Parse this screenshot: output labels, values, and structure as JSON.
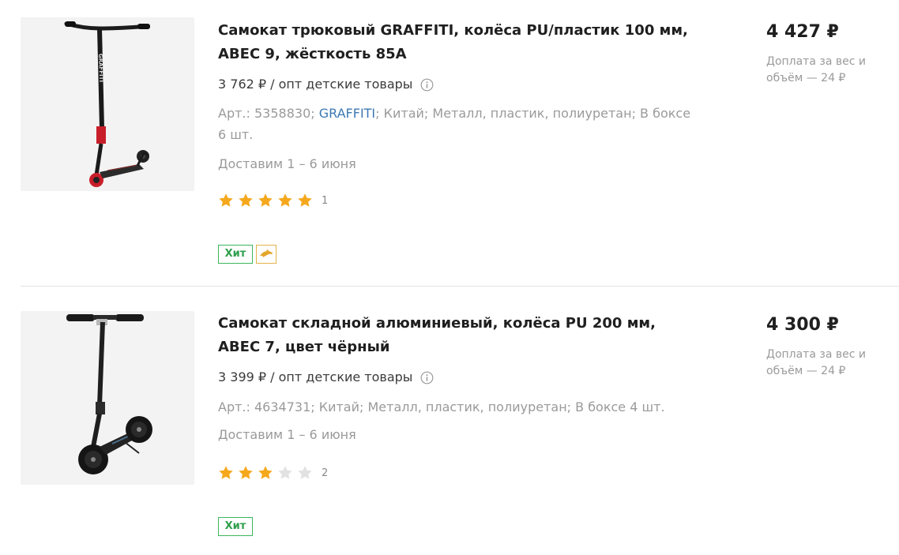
{
  "products": [
    {
      "title": "Самокат трюковый GRAFFITI, колёса PU/пластик 100 мм, ABEC 9, жёсткость 85A",
      "wholesale_price": "3 762 ₽ / опт детские товары",
      "meta_prefix": "Арт.: 5358830; ",
      "meta_brand": "GRAFFITI",
      "meta_suffix": "; Китай; Металл, пластик, полиуретан; В боксе 6 шт.",
      "delivery": "Доставим 1 – 6 июня",
      "rating": 5,
      "reviews_count": "1",
      "badge_hit": "Хит",
      "has_dolphin_badge": true,
      "price": "4 427 ₽",
      "surcharge": "Доплата за вес и объём — 24 ₽"
    },
    {
      "title": "Самокат складной алюминиевый, колёса PU 200 мм, ABEC 7, цвет чёрный",
      "wholesale_price": "3 399 ₽ / опт детские товары",
      "meta_prefix": "Арт.: 4634731; Китай; Металл, пластик, полиуретан; В боксе 4 шт.",
      "delivery": "Доставим 1 – 6 июня",
      "rating": 3,
      "reviews_count": "2",
      "badge_hit": "Хит",
      "has_dolphin_badge": false,
      "price": "4 300 ₽",
      "surcharge": "Доплата за вес и объём — 24 ₽"
    }
  ],
  "colors": {
    "star_filled": "#f5a81c",
    "star_empty": "#e2e2e2",
    "hit_badge": "#3cb55c",
    "dolphin_badge": "#e3b34a",
    "brand_link": "#3b79b4"
  }
}
